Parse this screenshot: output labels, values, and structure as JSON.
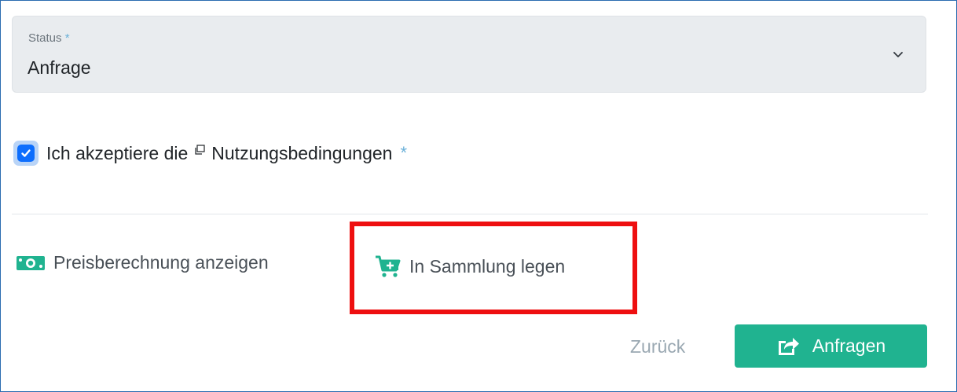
{
  "status_field": {
    "label": "Status",
    "required_mark": "*",
    "value": "Anfrage",
    "icon": "chevron-down-icon"
  },
  "terms": {
    "checked": true,
    "prefix": "Ich akzeptiere die",
    "link": "Nutzungsbedingungen",
    "required_mark": "*",
    "icon": "external-window-icon"
  },
  "actions": {
    "price": {
      "label": "Preisberechnung anzeigen",
      "icon": "money-icon"
    },
    "collect": {
      "label": "In Sammlung legen",
      "icon": "cart-plus-icon"
    }
  },
  "footer": {
    "back_label": "Zurück",
    "submit_label": "Anfragen",
    "submit_icon": "share-square-icon"
  },
  "colors": {
    "accent": "#20b390",
    "checkbox": "#0d6efd",
    "highlight": "#ee0f10",
    "required": "#6ab0d8"
  }
}
